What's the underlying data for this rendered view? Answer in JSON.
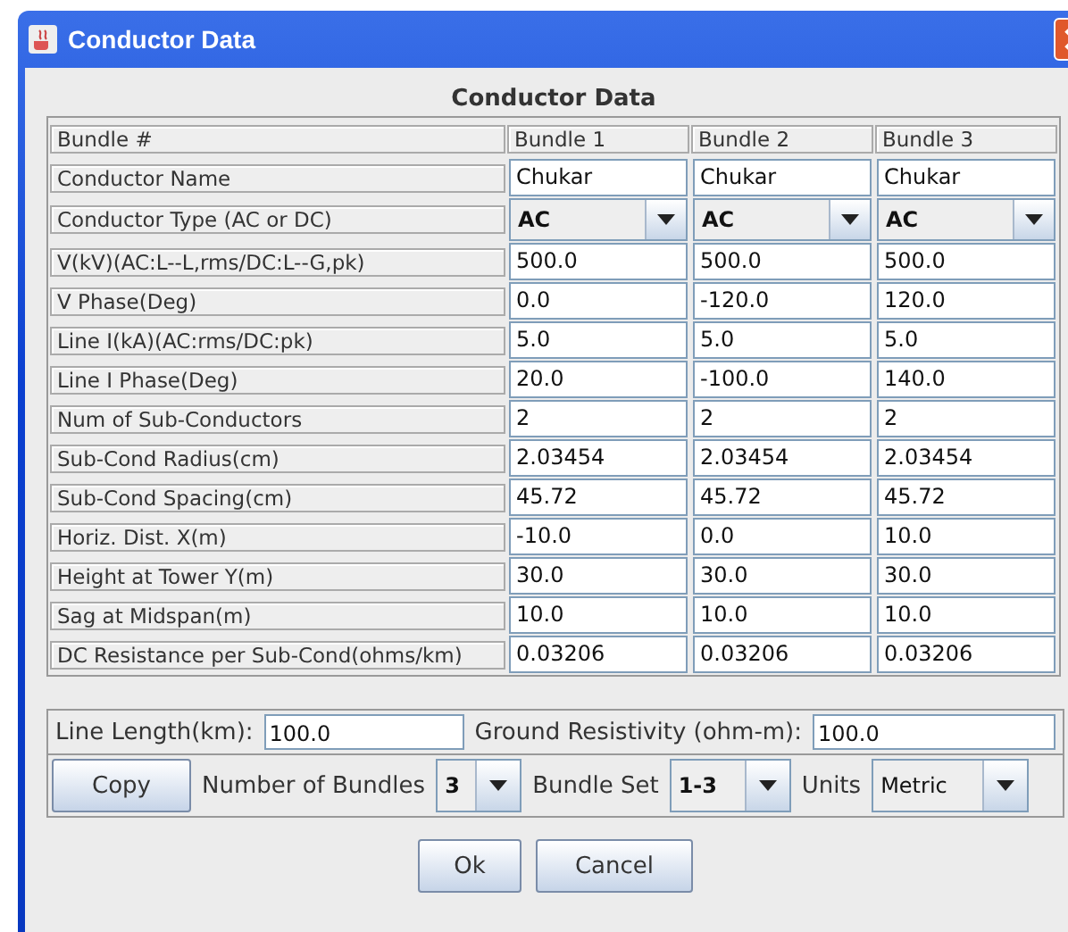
{
  "window": {
    "title": "Conductor Data"
  },
  "panel_title": "Conductor Data",
  "table": {
    "header": {
      "label": "Bundle #",
      "cells": [
        "Bundle 1",
        "Bundle 2",
        "Bundle 3"
      ]
    },
    "rows": [
      {
        "label": "Conductor Name",
        "kind": "text",
        "cells": [
          "Chukar",
          "Chukar",
          "Chukar"
        ]
      },
      {
        "label": "Conductor Type (AC or DC)",
        "kind": "combo",
        "cells": [
          "AC",
          "AC",
          "AC"
        ]
      },
      {
        "label": "V(kV)(AC:L--L,rms/DC:L--G,pk)",
        "kind": "text",
        "cells": [
          "500.0",
          "500.0",
          "500.0"
        ]
      },
      {
        "label": "V Phase(Deg)",
        "kind": "text",
        "cells": [
          "0.0",
          "-120.0",
          "120.0"
        ]
      },
      {
        "label": "Line I(kA)(AC:rms/DC:pk)",
        "kind": "text",
        "cells": [
          "5.0",
          "5.0",
          "5.0"
        ]
      },
      {
        "label": "Line I Phase(Deg)",
        "kind": "text",
        "cells": [
          "20.0",
          "-100.0",
          "140.0"
        ]
      },
      {
        "label": "Num of Sub-Conductors",
        "kind": "text",
        "cells": [
          "2",
          "2",
          "2"
        ]
      },
      {
        "label": "Sub-Cond Radius(cm)",
        "kind": "text",
        "cells": [
          "2.03454",
          "2.03454",
          "2.03454"
        ]
      },
      {
        "label": "Sub-Cond Spacing(cm)",
        "kind": "text",
        "cells": [
          "45.72",
          "45.72",
          "45.72"
        ]
      },
      {
        "label": "Horiz. Dist. X(m)",
        "kind": "text",
        "cells": [
          "-10.0",
          "0.0",
          "10.0"
        ]
      },
      {
        "label": "Height at Tower Y(m)",
        "kind": "text",
        "cells": [
          "30.0",
          "30.0",
          "30.0"
        ]
      },
      {
        "label": "Sag at Midspan(m)",
        "kind": "text",
        "cells": [
          "10.0",
          "10.0",
          "10.0"
        ]
      },
      {
        "label": "DC Resistance per Sub-Cond(ohms/km)",
        "kind": "text",
        "cells": [
          "0.03206",
          "0.03206",
          "0.03206"
        ]
      }
    ]
  },
  "line_length": {
    "label": "Line Length(km):",
    "value": "100.0"
  },
  "ground_resistivity": {
    "label": "Ground Resistivity (ohm-m):",
    "value": "100.0"
  },
  "copy_button": "Copy",
  "number_of_bundles": {
    "label": "Number of Bundles",
    "value": "3"
  },
  "bundle_set": {
    "label": "Bundle Set",
    "value": "1-3"
  },
  "units": {
    "label": "Units",
    "value": "Metric"
  },
  "buttons": [
    "Ok",
    "Cancel"
  ]
}
